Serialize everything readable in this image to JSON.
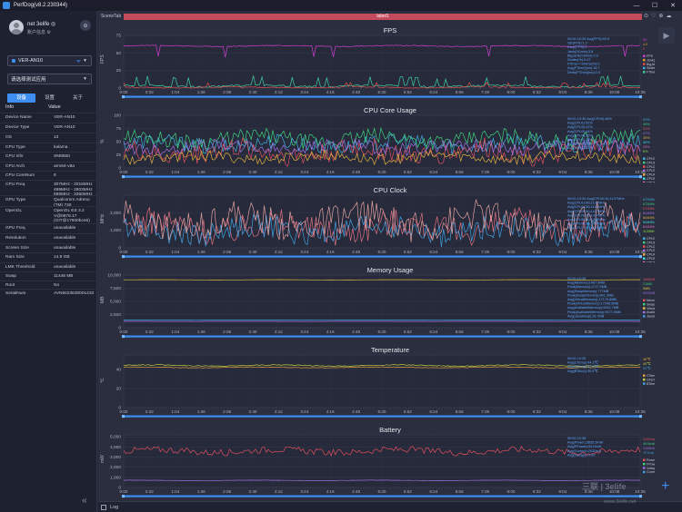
{
  "window": {
    "title": "PerfDog(v8.2.230344)",
    "minimize": "—",
    "maximize": "☐",
    "close": "✕"
  },
  "user": {
    "name": "net 3elife ◎",
    "role": "账户信息 ⚙",
    "logout_glyph": "⊖"
  },
  "device": {
    "selected": "VER-AN10",
    "wifi_glyph": "ᯤ"
  },
  "app": {
    "placeholder": "请选择测试应用"
  },
  "tabs": [
    {
      "label": "设备",
      "active": true
    },
    {
      "label": "设置",
      "active": false
    },
    {
      "label": "关于",
      "active": false
    }
  ],
  "info": {
    "header_key": "Info",
    "header_value": "Value",
    "rows": [
      {
        "k": "Device Name",
        "v": "VER-AN10"
      },
      {
        "k": "Device Type",
        "v": "VER-AN10"
      },
      {
        "k": "OS",
        "v": "13"
      },
      {
        "k": "CPU Type",
        "v": "kalama"
      },
      {
        "k": "CPU Info",
        "v": "SM8550"
      },
      {
        "k": "CPU Arch",
        "v": "arm64-v8a"
      },
      {
        "k": "CPU CoreNum",
        "v": "8"
      },
      {
        "k": "CPU Freq",
        "v": "307MHz - 2016MHz\n499MHz - 2803MHz\n595MHz - 3360MHz"
      },
      {
        "k": "GPU Type",
        "v": "Qualcomm Adreno (TM) 740"
      },
      {
        "k": "OpenGL",
        "v": "OpenGL ES 3.2 V@0676.17 (GIT@17600bce6)"
      },
      {
        "k": "GPU Freq",
        "v": "unavailable"
      },
      {
        "k": "Resolution",
        "v": "unavailable"
      },
      {
        "k": "Screen Size",
        "v": "unavailable"
      },
      {
        "k": "Ram Size",
        "v": "14.9 GB"
      },
      {
        "k": "LMK Threshold",
        "v": "unavailable"
      },
      {
        "k": "Swap",
        "v": "11446 MB"
      },
      {
        "k": "Root",
        "v": "No"
      },
      {
        "k": "SerialNum",
        "v": "AVN5023630001433"
      }
    ]
  },
  "scene": {
    "tab_label": "SceneTab",
    "label": "label1",
    "tools": [
      "⊙",
      "♡",
      "⊕",
      "☁"
    ]
  },
  "log_label": "Log",
  "watermark": {
    "main": "三联 | 3elife",
    "sub": "www.3elife.net"
  },
  "colors": {
    "accent": "#3e8df0",
    "label_band": "#c54a5b",
    "fps": "#d040d0",
    "memory_yellow": "#e0c040",
    "temp_green": "#c0d040"
  },
  "chart_data": [
    {
      "type": "line",
      "title": "FPS",
      "ylabel": "FPS",
      "yticks": [
        "0",
        "25",
        "50",
        "75"
      ],
      "ylim": [
        0,
        75
      ],
      "xticks": [
        "0:00",
        "0:32",
        "1:04",
        "1:36",
        "2:08",
        "2:40",
        "3:12",
        "3:44",
        "4:16",
        "4:48",
        "5:20",
        "5:52",
        "6:24",
        "6:56",
        "7:28",
        "8:00",
        "8:32",
        "9:04",
        "9:36",
        "10:08",
        "10:35"
      ],
      "series": [
        {
          "color": "#d040d0",
          "base": 60,
          "amp": 2,
          "noise": 0.3
        },
        {
          "color": "#40d0a0",
          "base": 3,
          "amp": 3,
          "noise": 0.5
        },
        {
          "color": "#e05050",
          "base": 1,
          "amp": 1.5,
          "noise": 0.5
        }
      ],
      "legend": [
        "FPS",
        "Jank(/10min)",
        "BigJank(/10min)",
        "Stutter(%)",
        "FTime(ms)"
      ],
      "legend_colors": [
        "#d040d0",
        "#e0a030",
        "#e05050",
        "#40b0e0",
        "#40d0a0"
      ],
      "stats": [
        "00:00-10:35 Avg(FPS):59.8",
        "Var(FPS):1.2",
        "Drop(FPS):0",
        "Jank(/10min):3.8",
        "BigJank(/10min):0.9",
        "Stutter(%):0.07",
        "FTime>=100ms(%):0",
        "Avg(FTime)(ms):16.7",
        "Delta(FTime)(ms):0.9"
      ],
      "values_right": [
        "50",
        "4.0",
        "0"
      ]
    },
    {
      "type": "line",
      "title": "CPU Core Usage",
      "ylabel": "%",
      "yticks": [
        "0",
        "25",
        "50",
        "75",
        "100"
      ],
      "ylim": [
        0,
        100
      ],
      "xticks": [
        "0:00",
        "0:32",
        "1:04",
        "1:36",
        "2:08",
        "2:40",
        "3:12",
        "3:44",
        "4:16",
        "4:48",
        "5:20",
        "5:52",
        "6:24",
        "6:56",
        "7:28",
        "8:00",
        "8:32",
        "9:04",
        "9:36",
        "10:08",
        "10:35"
      ],
      "series": [
        {
          "color": "#40b0e0",
          "base": 45,
          "amp": 15,
          "noise": 1
        },
        {
          "color": "#40d080",
          "base": 55,
          "amp": 15,
          "noise": 1
        },
        {
          "color": "#e05060",
          "base": 30,
          "amp": 20,
          "noise": 1
        },
        {
          "color": "#a070e0",
          "base": 40,
          "amp": 12,
          "noise": 1
        },
        {
          "color": "#e0b040",
          "base": 20,
          "amp": 10,
          "noise": 1
        }
      ],
      "legend": [
        "CPU0",
        "CPU1",
        "CPU2",
        "CPU3",
        "CPU4",
        "CPU5",
        "CPU6",
        "CPU7"
      ],
      "legend_colors": [
        "#40b0e0",
        "#40d080",
        "#e05060",
        "#a070e0",
        "#e0b040",
        "#40e0e0",
        "#e070c0",
        "#90e040"
      ],
      "stats": [
        "00:00-10:35 Avg(CPU0):48%",
        "Avg(CPU1):52%",
        "Avg(CPU2):41%",
        "Avg(CPU3):44%",
        "Avg(CPU4):35%",
        "Avg(CPU5):36%",
        "Avg(CPU6):30%",
        "Avg(CPU7):12%"
      ],
      "values_right": [
        "51%",
        "46%",
        "31%",
        "47%",
        "35%",
        "40%",
        "29%",
        "8%"
      ]
    },
    {
      "type": "line",
      "title": "CPU Clock",
      "ylabel": "MHz",
      "yticks": [
        "0",
        "1,000",
        "2,000"
      ],
      "ylim": [
        0,
        3000
      ],
      "xticks": [
        "0:00",
        "0:32",
        "1:04",
        "1:36",
        "2:08",
        "2:40",
        "3:12",
        "3:44",
        "4:16",
        "4:48",
        "5:20",
        "5:52",
        "6:24",
        "6:56",
        "7:28",
        "8:00",
        "8:32",
        "9:04",
        "9:36",
        "10:08",
        "10:35"
      ],
      "series": [
        {
          "color": "#e07080",
          "base": 1200,
          "amp": 800,
          "noise": 1
        },
        {
          "color": "#40a0e0",
          "base": 1000,
          "amp": 700,
          "noise": 1
        },
        {
          "color": "#e0a0a0",
          "base": 1500,
          "amp": 900,
          "noise": 1
        }
      ],
      "legend": [
        "CPU0",
        "CPU1",
        "CPU2",
        "CPU3",
        "CPU4",
        "CPU5",
        "CPU6",
        "CPU7"
      ],
      "legend_colors": [
        "#40b0e0",
        "#40d080",
        "#e05060",
        "#a070e0",
        "#e0b040",
        "#40e0e0",
        "#e070c0",
        "#90e040"
      ],
      "stats": [
        "00:00-10:35 Avg(CPU0Clk):1137MHz",
        "Avg(CPU1Clk):1137MHz",
        "Avg(CPU2Clk):1137MHz",
        "Avg(CPU3Clk):1427MHz",
        "Avg(CPU4Clk):1427MHz",
        "Avg(CPU5Clk):1427MHz",
        "Avg(CPU6Clk):1427MHz",
        "Avg(CPU7Clk):1152MHz"
      ],
      "values_right": [
        "672MHz",
        "672MHz",
        "672MHz",
        "844MHz",
        "844MHz",
        "844MHz",
        "844MHz",
        "1133MHz"
      ]
    },
    {
      "type": "line",
      "title": "Memory Usage",
      "ylabel": "MB",
      "yticks": [
        "0",
        "2,500",
        "5,000",
        "7,500",
        "10,000"
      ],
      "ylim": [
        0,
        10000
      ],
      "xticks": [
        "0:00",
        "0:32",
        "1:04",
        "1:36",
        "2:08",
        "2:40",
        "3:12",
        "3:44",
        "4:16",
        "4:48",
        "5:20",
        "5:52",
        "6:24",
        "6:56",
        "7:28",
        "8:00",
        "8:32",
        "9:04",
        "9:36",
        "10:08",
        "10:35"
      ],
      "series": [
        {
          "color": "#e0c040",
          "base": 9100,
          "amp": 60,
          "noise": 0.1
        },
        {
          "color": "#40a0e0",
          "base": 1450,
          "amp": 30,
          "noise": 0.1
        },
        {
          "color": "#a070e0",
          "base": 1200,
          "amp": 20,
          "noise": 0.1
        }
      ],
      "legend": [
        "Memory",
        "SwapMemory",
        "VirtualMemory",
        "AvailableMemory",
        "JavaHeap"
      ],
      "legend_colors": [
        "#e05060",
        "#40d080",
        "#e0c040",
        "#a070e0",
        "#40a0e0"
      ],
      "stats": [
        "00:00-10:35",
        "Avg(Memory):1467.9MB",
        "Peak(Memory):1717.9MB",
        "Avg(SwapMemory):777MB",
        "Peak(SwapMemory):841.0MB",
        "Avg(VirtualMemory):17179.8MB",
        "Peak(VirtualMemory):17246.6MB",
        "Avg(AvailableMemory):9452.7MB",
        "Peak(AvailableMemory):9477.0MB",
        "Avg(JavaHeap):16.7MB"
      ],
      "values_right": [
        "1566MB",
        "21MB",
        "9MB",
        "9321MB"
      ]
    },
    {
      "type": "line",
      "title": "Temperature",
      "ylabel": "℃",
      "yticks": [
        "0",
        "20",
        "40"
      ],
      "ylim": [
        0,
        55
      ],
      "xticks": [
        "0:00",
        "0:32",
        "1:04",
        "1:36",
        "2:08",
        "2:40",
        "3:12",
        "3:44",
        "4:16",
        "4:48",
        "5:20",
        "5:52",
        "6:24",
        "6:56",
        "7:28",
        "8:00",
        "8:32",
        "9:04",
        "9:36",
        "10:08",
        "10:35"
      ],
      "series": [
        {
          "color": "#c0d040",
          "base": 44,
          "amp": 1.5,
          "noise": 0.3
        },
        {
          "color": "#e0a040",
          "base": 42,
          "amp": 1,
          "noise": 0.3
        }
      ],
      "legend": [
        "CTemp",
        "GTemp",
        "BTemp"
      ],
      "legend_colors": [
        "#e0a040",
        "#c0d040",
        "#40a0e0"
      ],
      "stats": [
        "00:00-10:35",
        "Avg(CTemp):44.3℃",
        "Avg(GTemp):42.6℃",
        "Avg(BTemp):30.0℃"
      ],
      "values_right": [
        "46℃",
        "40℃",
        "31℃"
      ]
    },
    {
      "type": "line",
      "title": "Battery",
      "ylabel": "mW",
      "yticks": [
        "0",
        "1,000",
        "2,000",
        "3,000",
        "4,000",
        "5,000"
      ],
      "ylim": [
        0,
        5200
      ],
      "xticks": [
        "0:00",
        "0:32",
        "1:04",
        "1:36",
        "2:08",
        "2:40",
        "3:12",
        "3:44",
        "4:16",
        "4:48",
        "5:20",
        "5:52",
        "6:24",
        "6:56",
        "7:28",
        "8:00",
        "8:32",
        "9:04",
        "9:36",
        "10:08",
        "10:35"
      ],
      "series": [
        {
          "color": "#e05060",
          "base": 3600,
          "amp": 400,
          "noise": 0.8
        },
        {
          "color": "#a070e0",
          "base": 700,
          "amp": 50,
          "noise": 0.2
        }
      ],
      "legend": [
        "Power",
        "FPower",
        "Voltage",
        "Current"
      ],
      "legend_colors": [
        "#e05060",
        "#40d080",
        "#a070e0",
        "#40a0e0"
      ],
      "stats": [
        "00:00-10:35",
        "Avg(Power):3655.5mW",
        "Avg(FPower):53.0mW",
        "Avg(Current):2032mA",
        "Avg(Voltage):4.0V"
      ],
      "values_right": [
        "3100mW",
        "49.0mW",
        "4166mV",
        "727mA"
      ]
    }
  ]
}
